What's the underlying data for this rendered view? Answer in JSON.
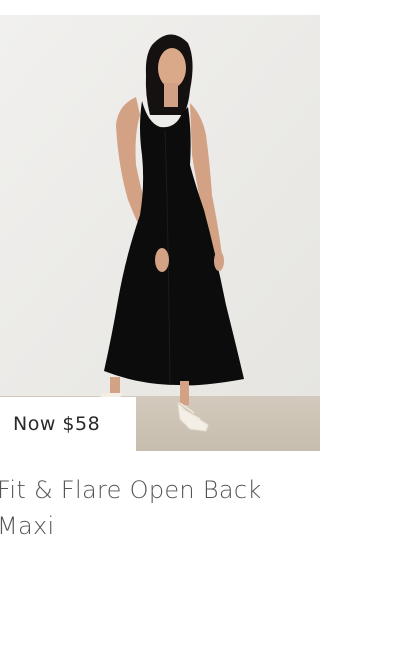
{
  "product": {
    "price_label": "Now $58",
    "title": "Fit & Flare Open Back Maxi"
  },
  "colors": {
    "wall": "#ededea",
    "floor": "#cfc6b8",
    "dress": "#0c0c0c",
    "price_text": "#2a2a2a",
    "title_text": "#545454"
  }
}
